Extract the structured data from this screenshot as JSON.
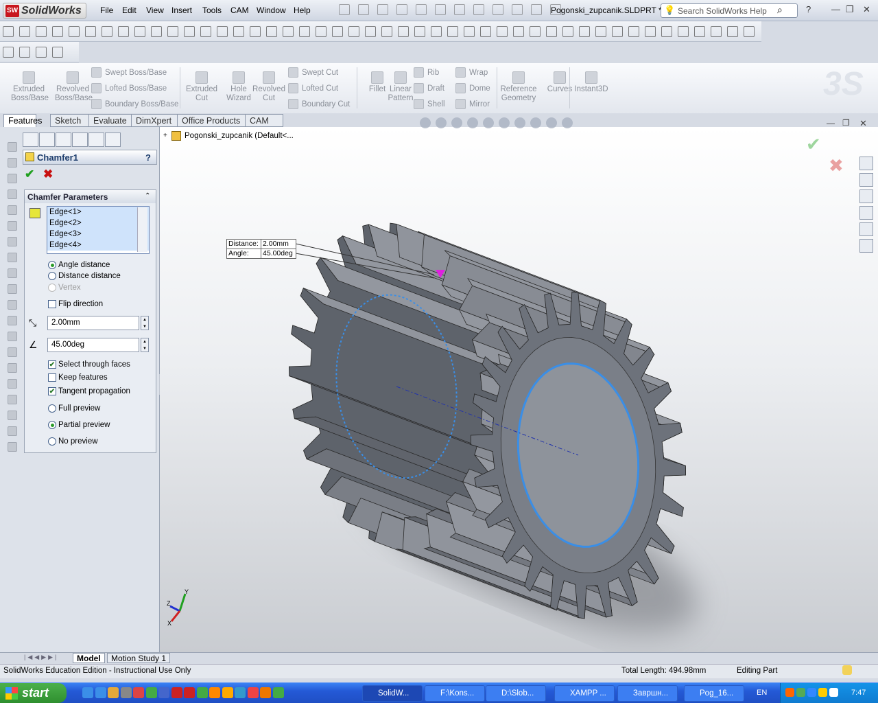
{
  "app": {
    "logo": "SolidWorks",
    "doc_title": "Pogonski_zupcanik.SLDPRT *",
    "search_placeholder": "Search SolidWorks Help"
  },
  "menu": [
    "File",
    "Edit",
    "View",
    "Insert",
    "Tools",
    "CAM",
    "Window",
    "Help"
  ],
  "command_manager": {
    "large": [
      {
        "label": "Extruded\nBoss/Base"
      },
      {
        "label": "Revolved\nBoss/Base"
      },
      {
        "label": "Extruded\nCut"
      },
      {
        "label": "Hole\nWizard"
      },
      {
        "label": "Revolved\nCut"
      },
      {
        "label": "Fillet"
      },
      {
        "label": "Linear\nPattern"
      },
      {
        "label": "Reference\nGeometry"
      },
      {
        "label": "Curves"
      },
      {
        "label": "Instant3D"
      }
    ],
    "small": [
      "Swept Boss/Base",
      "Lofted Boss/Base",
      "Boundary Boss/Base",
      "Swept Cut",
      "Lofted Cut",
      "Boundary Cut",
      "Rib",
      "Draft",
      "Shell",
      "Wrap",
      "Dome",
      "Mirror"
    ]
  },
  "tabs": [
    "Features",
    "Sketch",
    "Evaluate",
    "DimXpert",
    "Office Products",
    "CAM"
  ],
  "active_tab": "Features",
  "tree": {
    "root": "Pogonski_zupcanik  (Default<..."
  },
  "property_manager": {
    "title": "Chamfer1",
    "help": "?",
    "group_title": "Chamfer Parameters",
    "edges": [
      "Edge<1>",
      "Edge<2>",
      "Edge<3>",
      "Edge<4>"
    ],
    "options": {
      "angle_distance": "Angle distance",
      "distance_distance": "Distance distance",
      "vertex": "Vertex",
      "flip": "Flip direction"
    },
    "distance": "2.00mm",
    "angle": "45.00deg",
    "checks": {
      "select_through": "Select through faces",
      "keep_features": "Keep features",
      "tangent": "Tangent propagation"
    },
    "preview": {
      "full": "Full preview",
      "partial": "Partial preview",
      "none": "No preview"
    },
    "state": {
      "mode": "angle_distance",
      "select_through": true,
      "keep_features": false,
      "tangent": true,
      "flip": false,
      "preview": "partial"
    }
  },
  "callout": {
    "distance_label": "Distance:",
    "distance_value": "2.00mm",
    "angle_label": "Angle:",
    "angle_value": "45.00deg"
  },
  "triad": {
    "x": "X",
    "y": "Y",
    "z": "Z"
  },
  "bottom_tabs": [
    "Model",
    "Motion Study 1"
  ],
  "status": {
    "edition": "SolidWorks Education Edition - Instructional Use Only",
    "total_length": "Total Length: 494.98mm",
    "mode": "Editing Part"
  },
  "taskbar": {
    "start": "start",
    "tasks": [
      "SolidW...",
      "F:\\Kons...",
      "D:\\Slob...",
      "XAMPP ...",
      "Завршн...",
      "Pog_16..."
    ],
    "lang": "EN",
    "clock": "7:47"
  },
  "colors": {
    "accent": "#3399ff",
    "gear": "#6b7280",
    "selection": "#3a8ee6"
  }
}
